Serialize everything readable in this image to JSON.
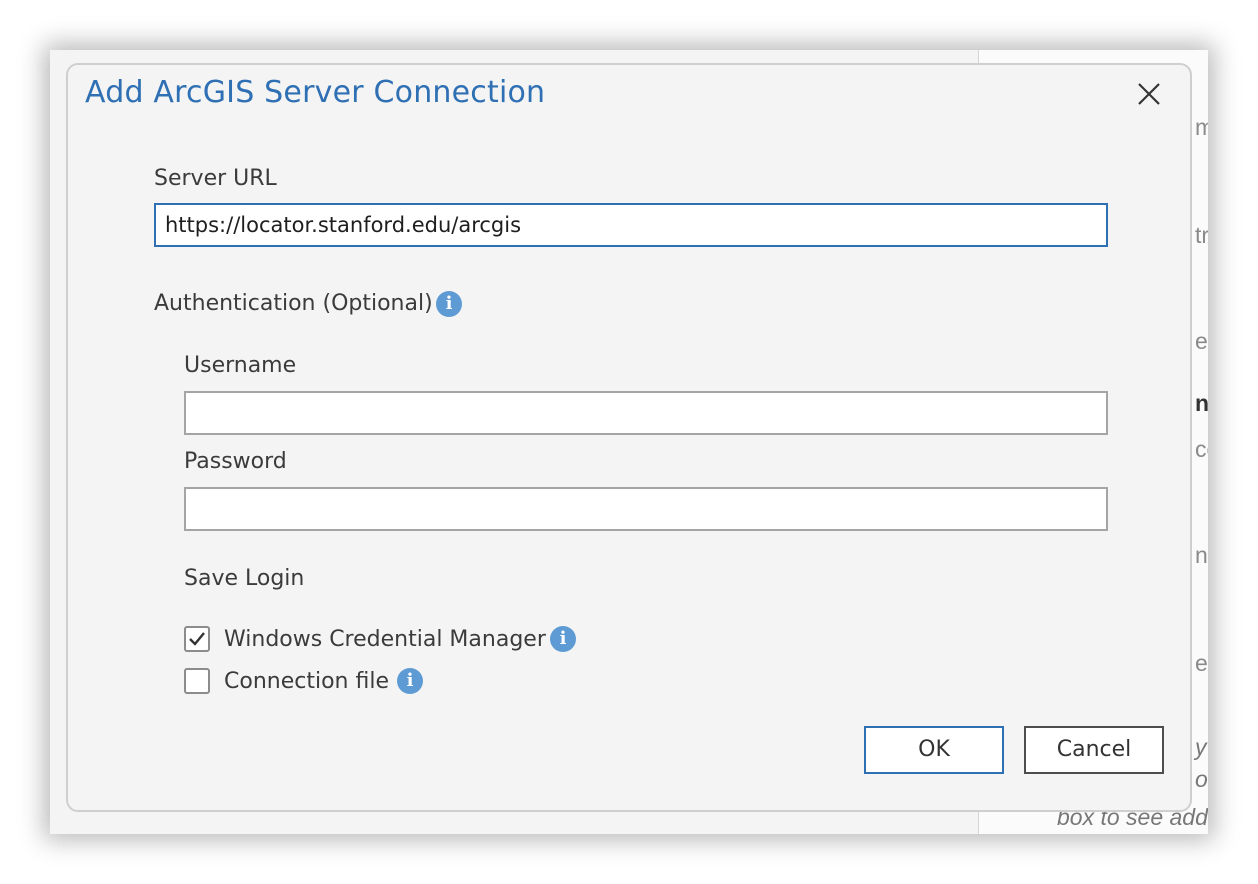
{
  "dialog": {
    "title": "Add ArcGIS Server Connection",
    "close_icon": "close-icon"
  },
  "server_url": {
    "label": "Server URL",
    "value": "https://locator.stanford.edu/arcgis"
  },
  "authentication": {
    "label": "Authentication (Optional)",
    "info_icon": "info-icon",
    "username_label": "Username",
    "username_value": "",
    "password_label": "Password",
    "password_value": ""
  },
  "save_login": {
    "label": "Save Login",
    "options": [
      {
        "label": "Windows Credential Manager",
        "checked": true,
        "icon": "info-icon"
      },
      {
        "label": "Connection file",
        "checked": false,
        "icon": "info-icon"
      }
    ]
  },
  "buttons": {
    "ok": "OK",
    "cancel": "Cancel"
  },
  "background_fragments": [
    "m",
    "tr",
    "ed",
    "n",
    "ce",
    "n",
    "e",
    "y",
    "ou",
    "box to see additio"
  ],
  "colors": {
    "title": "#2f6fb3",
    "focus_border": "#2f6fb3",
    "info_icon": "#5e9bd4"
  }
}
